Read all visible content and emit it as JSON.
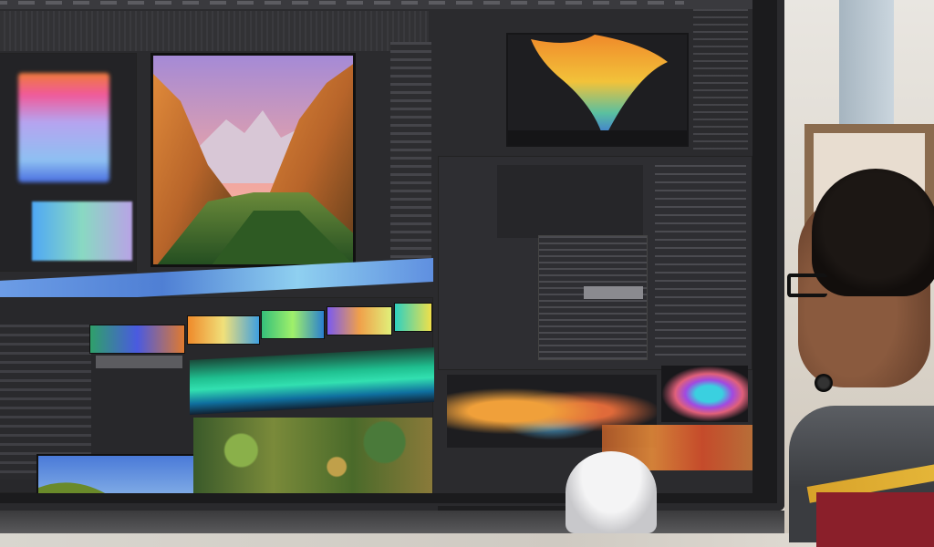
{
  "scene": {
    "description_label": "",
    "monitor": {
      "panels": [
        "source-monitor",
        "program-viewer",
        "effect-preview",
        "timeline",
        "properties-list"
      ]
    },
    "icons": [
      "monitor-icon"
    ],
    "colors": {
      "ui_dark": "#2b2b2e",
      "accent_blue": "#4f7fd4",
      "accent_orange": "#f0903a",
      "accent_green": "#1fc090"
    }
  }
}
